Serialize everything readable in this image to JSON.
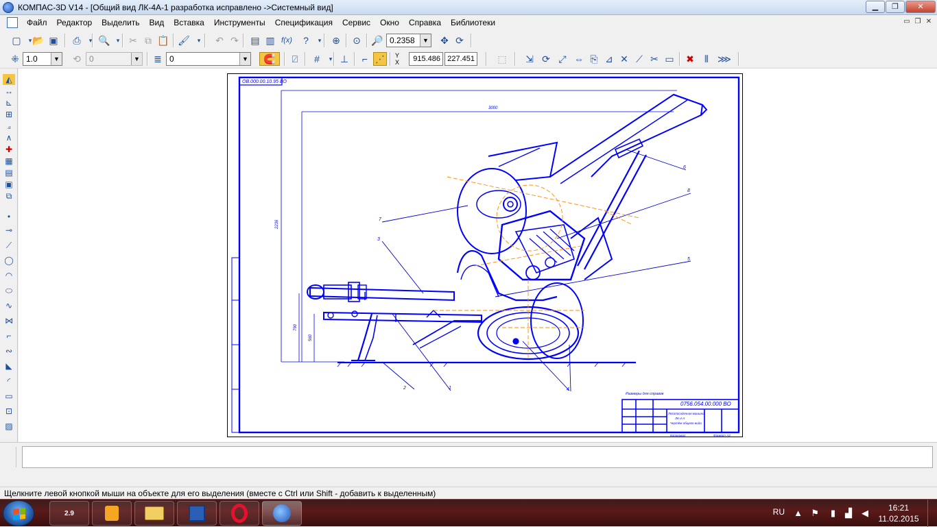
{
  "window": {
    "title": "КОМПАС-3D V14 - [Общий вид ЛК-4А-1 разработка исправлено ->Системный вид]",
    "minimize": "▁",
    "restore": "❐",
    "close": "✕"
  },
  "menu": {
    "items": [
      "Файл",
      "Редактор",
      "Выделить",
      "Вид",
      "Вставка",
      "Инструменты",
      "Спецификация",
      "Сервис",
      "Окно",
      "Справка",
      "Библиотеки"
    ],
    "mdi_minimize": "▭",
    "mdi_restore": "❐",
    "mdi_close": "✕"
  },
  "toolbar1": {
    "zoom_value": "0.2358",
    "fx_label": "f(x)"
  },
  "toolbar2": {
    "step_value": "1.0",
    "angle_value": "0",
    "layer_value": "0",
    "coord_x": "915.486",
    "coord_y": "227.451",
    "xy_label": "Y X"
  },
  "drawing": {
    "stamp_code": "ОВ.000.00.10.95 ВО",
    "dimension_top": "3000",
    "dimension_height": "2236",
    "dimension_a": "790",
    "dimension_b": "560",
    "callouts": [
      "7",
      "3",
      "6",
      "8",
      "5",
      "2",
      "1",
      "4"
    ],
    "note": "Размеры для справок",
    "title_block": {
      "doc_code": "0756.054.00.000 ВО",
      "name_line1": "Лесопосадочная машина",
      "name_line2": "ЛК-4-А",
      "name_line3": "Чертёж общего вида",
      "copied": "Копировал",
      "format": "Формат А3"
    }
  },
  "status": {
    "hint": "Щелкните левой кнопкой мыши на объекте для его выделения (вместе с Ctrl или Shift - добавить к выделенным)"
  },
  "taskbar": {
    "apps": [
      "city-info",
      "mix-app",
      "file-explorer",
      "save-app",
      "opera",
      "kompas"
    ],
    "language": "RU",
    "time": "16:21",
    "date": "11.02.2015",
    "cityinfo_label": "2.9"
  },
  "colors": {
    "drawing_blue": "#0000ff",
    "construction_orange": "#ff8c00",
    "taskbar_red": "#5b1a1a"
  }
}
